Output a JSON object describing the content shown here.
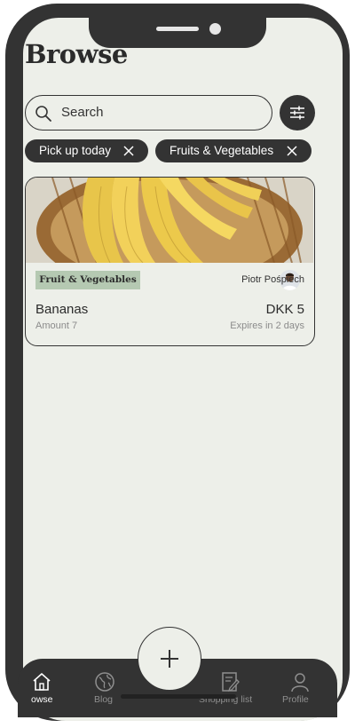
{
  "header": {
    "title": "Browse"
  },
  "search": {
    "placeholder": "Search"
  },
  "filters": {
    "active": [
      {
        "label": "Pick up today"
      },
      {
        "label": "Fruits & Vegetables"
      }
    ]
  },
  "listings": [
    {
      "category": "Fruit & Vegetables",
      "seller": "Piotr Pośpiech",
      "name": "Bananas",
      "price": "DKK 5",
      "amount": "Amount 7",
      "expires": "Expires in 2 days"
    }
  ],
  "tabbar": {
    "tabs": [
      {
        "label": "owse",
        "icon": "home-icon",
        "active": true
      },
      {
        "label": "Blog",
        "icon": "globe-icon",
        "active": false
      },
      {
        "label": "Shopping list",
        "icon": "list-edit-icon",
        "active": false
      },
      {
        "label": "Profile",
        "icon": "user-icon",
        "active": false
      }
    ],
    "fab_icon": "plus-icon"
  },
  "colors": {
    "frame": "#333333",
    "background": "#edefe9",
    "category_badge": "#b5c9b2",
    "muted_text": "#8b8b8b"
  }
}
